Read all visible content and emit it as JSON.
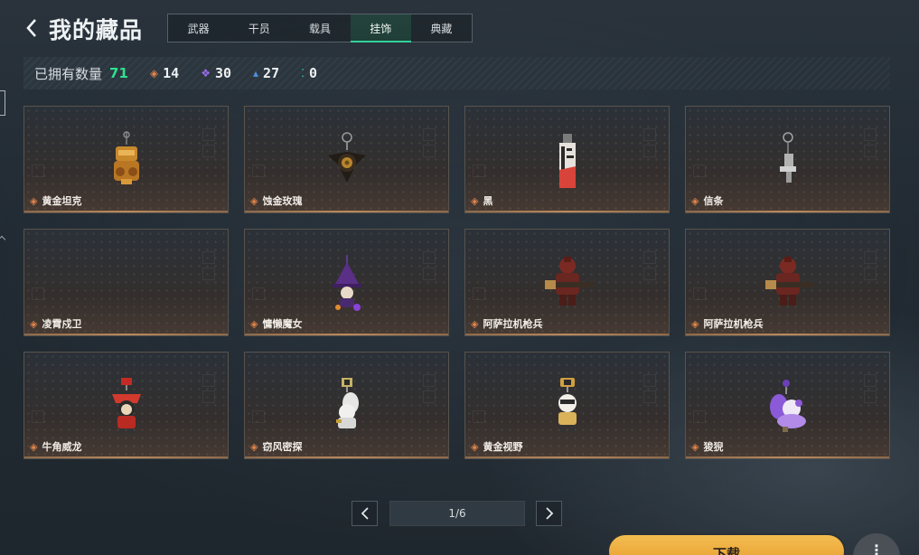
{
  "header": {
    "title": "我的藏品",
    "tabs": [
      {
        "label": "武器",
        "active": false
      },
      {
        "label": "干员",
        "active": false
      },
      {
        "label": "载具",
        "active": false
      },
      {
        "label": "挂饰",
        "active": true
      },
      {
        "label": "典藏",
        "active": false
      }
    ]
  },
  "summary": {
    "owned_label": "已拥有数量",
    "owned_total": "71",
    "rarities": [
      {
        "icon": "orange-gem-icon",
        "color": "#e0854a",
        "count": "14"
      },
      {
        "icon": "purple-gem-icon",
        "color": "#9a6cf0",
        "count": "30"
      },
      {
        "icon": "blue-gem-icon",
        "color": "#4f8fe0",
        "count": "27"
      },
      {
        "icon": "green-gem-icon",
        "color": "#33d19a",
        "count": "0"
      }
    ]
  },
  "items": [
    {
      "name": "黄金坦克",
      "charm": "golden-tank"
    },
    {
      "name": "蚀金玫瑰",
      "charm": "rose"
    },
    {
      "name": "黑",
      "charm": "card"
    },
    {
      "name": "信条",
      "charm": "pistol"
    },
    {
      "name": "凌霄戍卫",
      "charm": "empty"
    },
    {
      "name": "慵懒魔女",
      "charm": "witch"
    },
    {
      "name": "阿萨拉机枪兵",
      "charm": "gunner"
    },
    {
      "name": "阿萨拉机枪兵",
      "charm": "gunner"
    },
    {
      "name": "牛角威龙",
      "charm": "bull"
    },
    {
      "name": "窃风密探",
      "charm": "spy"
    },
    {
      "name": "黄金视野",
      "charm": "vision"
    },
    {
      "name": "狻猊",
      "charm": "lion"
    }
  ],
  "pagination": {
    "indicator": "1/6",
    "prev_icon": "chevron-left-icon",
    "next_icon": "chevron-right-icon"
  },
  "footer": {
    "download_label": "下载",
    "more_label": "⋮"
  },
  "colors": {
    "accent_green": "#2ee08f",
    "tab_active": "#33d19a",
    "download": "#f0b043"
  }
}
